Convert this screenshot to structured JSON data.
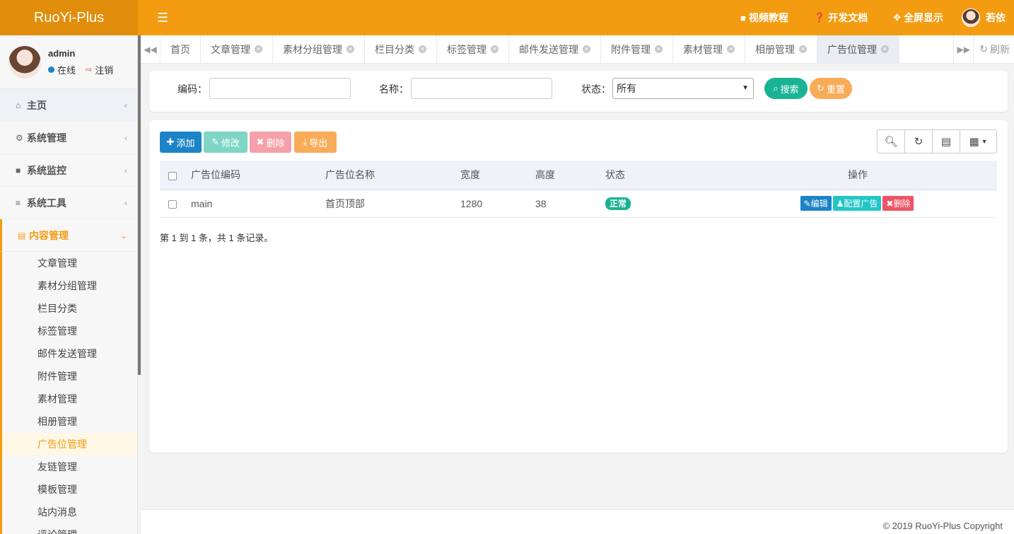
{
  "brand": "RuoYi-Plus",
  "header": {
    "menu_icon": "hamburger-icon",
    "links": [
      {
        "icon": "video-icon",
        "label": "视频教程"
      },
      {
        "icon": "question-icon",
        "label": "开发文档"
      },
      {
        "icon": "fullscreen-icon",
        "label": "全屏显示"
      }
    ],
    "user_name": "若依"
  },
  "sidebar": {
    "user": {
      "name": "admin",
      "status": "在线",
      "logout": "注销"
    },
    "items": [
      {
        "icon": "home-icon",
        "label": "主页"
      },
      {
        "icon": "gear-icon",
        "label": "系统管理"
      },
      {
        "icon": "video-icon",
        "label": "系统监控"
      },
      {
        "icon": "bars-icon",
        "label": "系统工具"
      },
      {
        "icon": "id-card-icon",
        "label": "内容管理"
      }
    ],
    "subitems": [
      "文章管理",
      "素材分组管理",
      "栏目分类",
      "标签管理",
      "邮件发送管理",
      "附件管理",
      "素材管理",
      "相册管理",
      "广告位管理",
      "友链管理",
      "模板管理",
      "站内消息",
      "评论管理"
    ]
  },
  "tabs": {
    "items": [
      "首页",
      "文章管理",
      "素材分组管理",
      "栏目分类",
      "标签管理",
      "邮件发送管理",
      "附件管理",
      "素材管理",
      "相册管理",
      "广告位管理"
    ],
    "active": "广告位管理",
    "refresh": "刷新"
  },
  "search": {
    "code_label": "编码：",
    "name_label": "名称：",
    "status_label": "状态：",
    "status_value": "所有",
    "search_btn": "搜索",
    "reset_btn": "重置"
  },
  "toolbar": {
    "add": "添加",
    "edit": "修改",
    "delete": "删除",
    "export": "导出"
  },
  "table": {
    "headers": [
      "广告位编码",
      "广告位名称",
      "宽度",
      "高度",
      "状态",
      "操作"
    ],
    "rows": [
      {
        "code": "main",
        "name": "首页顶部",
        "width": "1280",
        "height": "38",
        "status": "正常",
        "actions": [
          "编辑",
          "配置广告",
          "删除"
        ]
      }
    ]
  },
  "pager": "第 1 到 1 条，共 1 条记录。",
  "footer": "© 2019 RuoYi-Plus Copyright",
  "colors": {
    "brand": "#f39c12",
    "brand_dark": "#e08e0b",
    "primary": "#1c84c6",
    "success": "#1ab394",
    "info": "#23c6c8",
    "danger": "#ed5565",
    "warning": "#f8ac59"
  }
}
